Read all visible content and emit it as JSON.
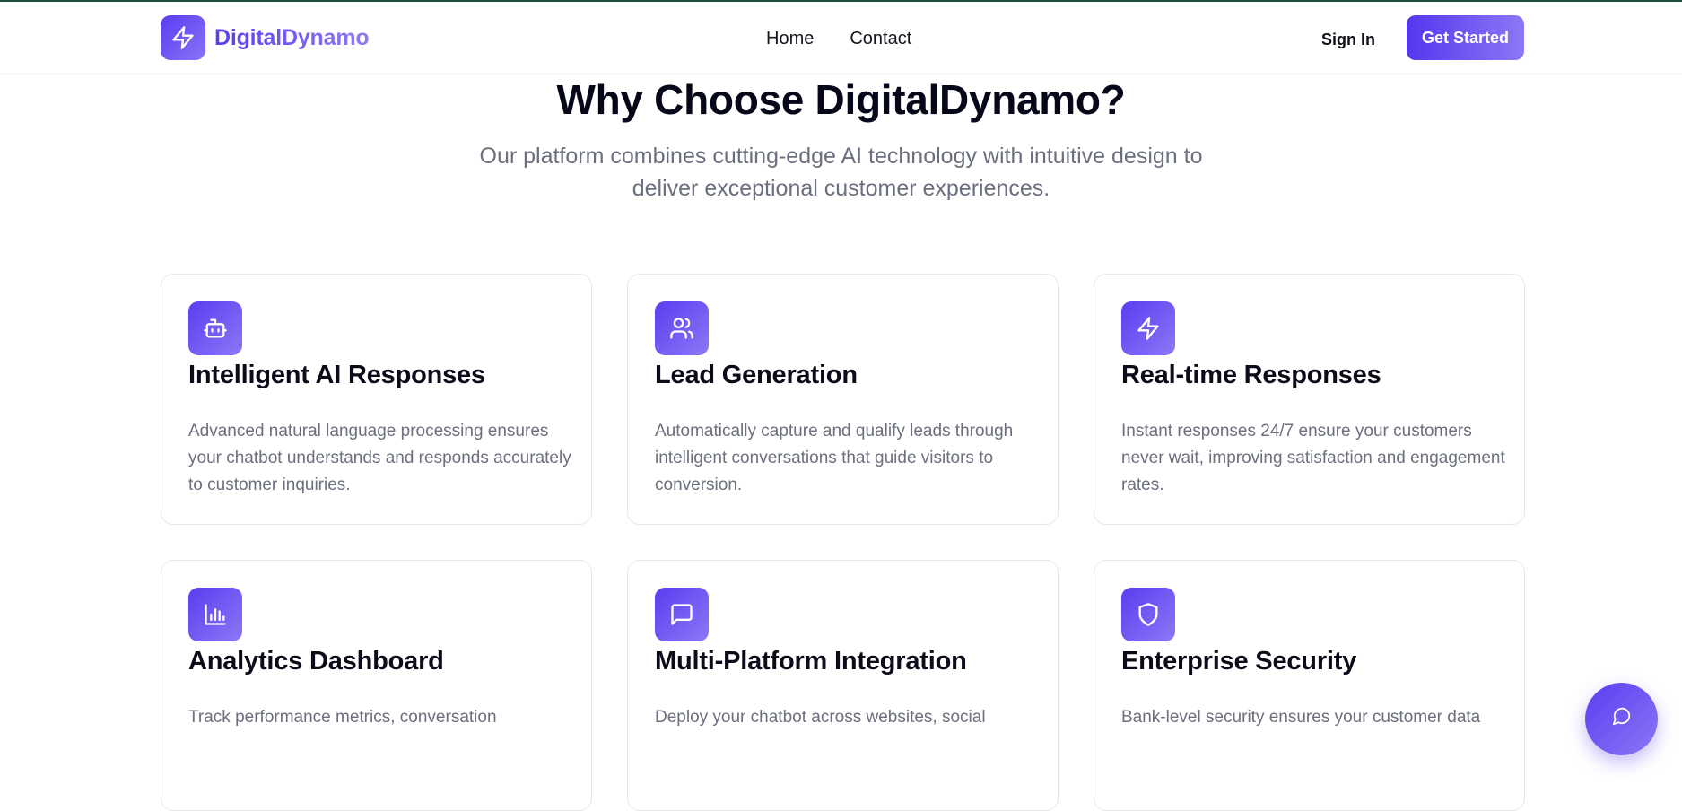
{
  "brand": {
    "name": "DigitalDynamo",
    "icon": "lightning-icon",
    "accent": "#5b3cf0",
    "accent_light": "#8b78f6"
  },
  "nav": {
    "items": [
      "Home",
      "Contact"
    ]
  },
  "header_actions": {
    "sign_in": "Sign In",
    "get_started": "Get Started"
  },
  "hero": {
    "title": "Why Choose DigitalDynamo?",
    "subtitle": "Our platform combines cutting-edge AI technology with intuitive design to deliver exceptional customer experiences."
  },
  "features": [
    {
      "icon": "bot-icon",
      "title": "Intelligent AI Responses",
      "description": "Advanced natural language processing ensures your chatbot understands and responds accurately to customer inquiries."
    },
    {
      "icon": "users-icon",
      "title": "Lead Generation",
      "description": "Automatically capture and qualify leads through intelligent conversations that guide visitors to conversion."
    },
    {
      "icon": "lightning-icon",
      "title": "Real-time Responses",
      "description": "Instant responses 24/7 ensure your customers never wait, improving satisfaction and engagement rates."
    },
    {
      "icon": "bar-chart-icon",
      "title": "Analytics Dashboard",
      "description": "Track performance metrics, conversation"
    },
    {
      "icon": "message-square-icon",
      "title": "Multi-Platform Integration",
      "description": "Deploy your chatbot across websites, social"
    },
    {
      "icon": "shield-icon",
      "title": "Enterprise Security",
      "description": "Bank-level security ensures your customer data"
    }
  ],
  "chat_widget": {
    "icon": "chat-bubble-icon"
  }
}
